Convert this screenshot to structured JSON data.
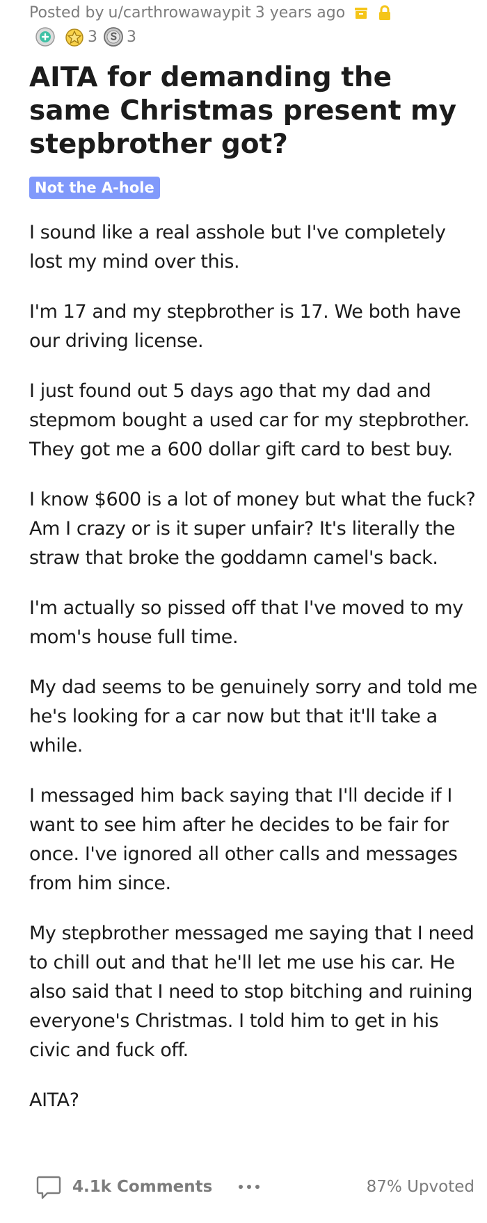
{
  "post": {
    "meta": {
      "prefix": "Posted by",
      "author": "u/carthrowawaypit",
      "age": "3 years ago"
    },
    "awards": [
      {
        "icon": "helpful-award-icon",
        "count": ""
      },
      {
        "icon": "wholesome-award-icon",
        "count": "3"
      },
      {
        "icon": "silver-award-icon",
        "count": "3"
      }
    ],
    "title": "AITA for demanding the same Christmas present my stepbrother got?",
    "flair": "Not the A-hole",
    "paragraphs": [
      "I sound like a real asshole but I've completely lost my mind over this.",
      "I'm 17 and my stepbrother is 17. We both have our driving license.",
      "I just found out 5 days ago that my dad and stepmom bought a used car for my stepbrother. They got me a 600 dollar gift card to best buy.",
      "I know $600 is a lot of money but what the fuck? Am I crazy or is it super unfair? It's literally the straw that broke the goddamn camel's back.",
      "I'm actually so pissed off that I've moved to my mom's house full time.",
      "My dad seems to be genuinely sorry and told me he's looking for a car now but that it'll take a while.",
      "I messaged him back saying that I'll decide if I want to see him after he decides to be fair for once. I've ignored all other calls and messages from him since.",
      "My stepbrother messaged me saying that I need to chill out and that he'll let me use his car. He also said that I need to stop bitching and ruining everyone's Christmas. I told him to get in his civic and fuck off.",
      "AITA?"
    ],
    "footer": {
      "comments": "4.1k Comments",
      "upvoted": "87% Upvoted"
    }
  },
  "colors": {
    "flair_bg": "#8099fb",
    "muted_text": "#7c7c7c",
    "archive_icon": "#f5c518",
    "lock_icon": "#f5c518"
  }
}
